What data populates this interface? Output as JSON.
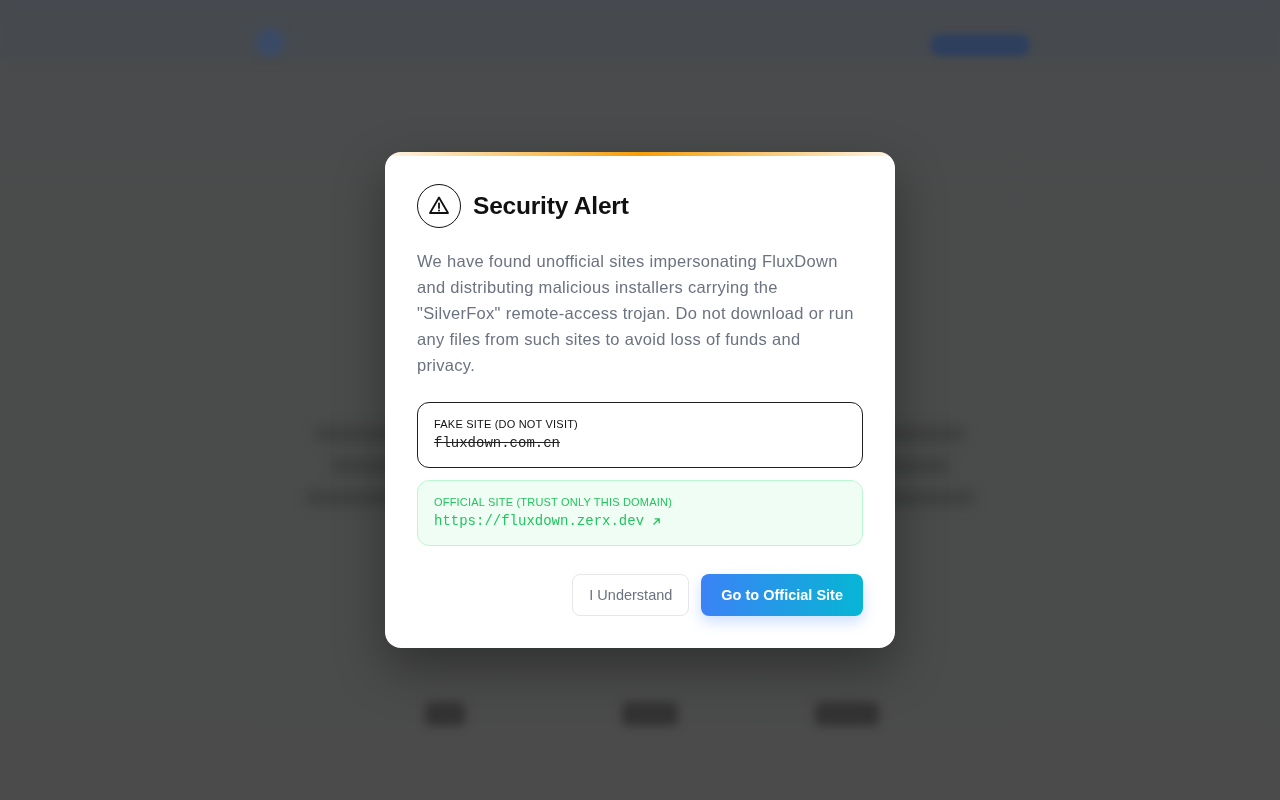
{
  "dialog": {
    "title": "Security Alert",
    "message": "We have found unofficial sites impersonating FluxDown and distributing malicious installers carrying the \"SilverFox\" remote-access trojan. Do not download or run any files from such sites to avoid loss of funds and privacy.",
    "sites": [
      {
        "kind": "fake",
        "label": "FAKE SITE (DO NOT VISIT)",
        "address": "fluxdown.com.cn"
      },
      {
        "kind": "official",
        "label": "OFFICIAL SITE (TRUST ONLY THIS DOMAIN)",
        "address": "https://fluxdown.zerx.dev"
      }
    ],
    "buttons": [
      {
        "kind": "secondary",
        "label": "I Understand"
      },
      {
        "kind": "primary",
        "label": "Go to Official Site"
      }
    ]
  }
}
